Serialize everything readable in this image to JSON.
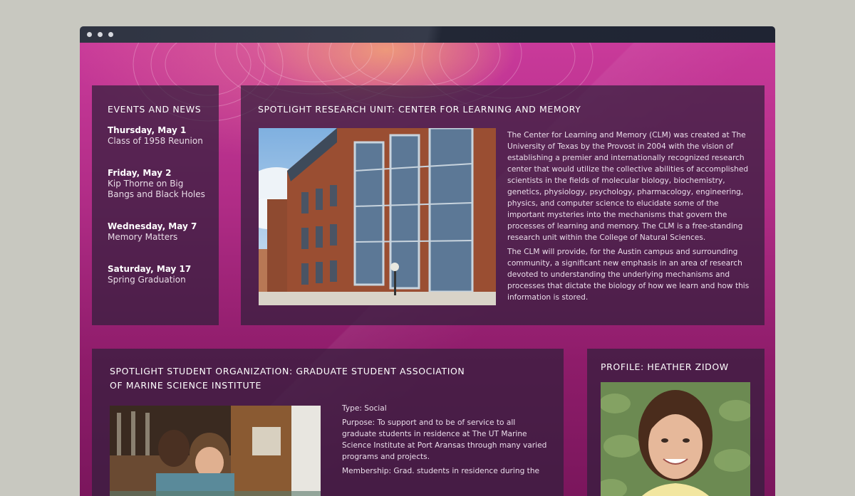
{
  "window": {
    "controls": [
      "dot",
      "dot",
      "dot"
    ]
  },
  "events": {
    "title": "EVENTS AND NEWS",
    "items": [
      {
        "date": "Thursday, May 1",
        "desc": "Class of 1958 Reunion"
      },
      {
        "date": "Friday, May 2",
        "desc": "Kip Thorne on Big Bangs and Black Holes"
      },
      {
        "date": "Wednesday, May 7",
        "desc": "Memory Matters"
      },
      {
        "date": "Saturday, May 17",
        "desc": "Spring Graduation"
      }
    ]
  },
  "research": {
    "title": "SPOTLIGHT RESEARCH UNIT: CENTER FOR LEARNING AND MEMORY",
    "paragraph1": "The Center for Learning and Memory (CLM) was created at The University of Texas by the Provost in 2004 with the vision of establishing a premier and internationally recognized research center that would utilize the collective abilities of accomplished scientists in the fields of molecular biology, biochemistry, genetics, physiology, psychology, pharmacology, engineering, physics, and computer science to elucidate some of the important mysteries into the mechanisms that govern the processes of learning and memory. The CLM is a free-standing research unit within the College of Natural Sciences.",
    "paragraph2": "The CLM will provide, for the Austin campus and surrounding community, a significant new emphasis in an area of research devoted to understanding the underlying mechanisms and processes that dictate the biology of how we learn and how this information is stored."
  },
  "student_org": {
    "title_line1": "SPOTLIGHT STUDENT ORGANIZATION: GRADUATE STUDENT ASSOCIATION",
    "title_line2": "OF MARINE SCIENCE INSTITUTE",
    "type_label": "Type:",
    "type_value": "Social",
    "purpose_label": "Purpose:",
    "purpose_value": "To support and to be of service to all graduate students in residence at The UT Marine Science Institute at Port Aransas through many varied programs and projects.",
    "membership_label": "Membership:",
    "membership_value": "Grad. students in residence during the"
  },
  "profile": {
    "title": "PROFILE: HEATHER ZIDOW"
  },
  "colors": {
    "background": "#c8c8c0",
    "titlebar": "#2a2f3d",
    "magenta": "#b02c86",
    "panel": "rgba(50,30,60,0.72)"
  }
}
